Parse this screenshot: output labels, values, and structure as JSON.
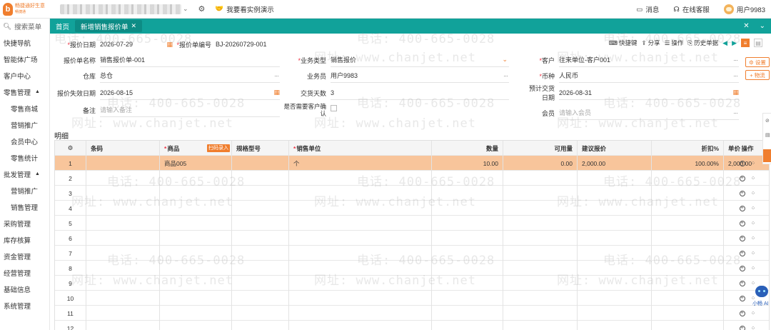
{
  "topbar": {
    "brand_line1": "畅捷通好生意",
    "brand_line2": "畅捷通",
    "demo_label": "我要看实例演示",
    "messages_label": "消息",
    "support_label": "在线客服",
    "user_label": "用户9983"
  },
  "sidebar": {
    "search_placeholder": "搜索菜单",
    "items": [
      {
        "label": "快捷导航",
        "sub": false
      },
      {
        "label": "智能体广场",
        "sub": false
      },
      {
        "label": "客户中心",
        "sub": false
      },
      {
        "label": "零售管理",
        "sub": false,
        "expanded": true
      },
      {
        "label": "零售商城",
        "sub": true
      },
      {
        "label": "营销推广",
        "sub": true
      },
      {
        "label": "会员中心",
        "sub": true
      },
      {
        "label": "零售统计",
        "sub": true
      },
      {
        "label": "批发管理",
        "sub": false,
        "expanded": true
      },
      {
        "label": "营销推广",
        "sub": true
      },
      {
        "label": "销售管理",
        "sub": true
      },
      {
        "label": "采购管理",
        "sub": false
      },
      {
        "label": "库存核算",
        "sub": false
      },
      {
        "label": "资金管理",
        "sub": false
      },
      {
        "label": "经营管理",
        "sub": false
      },
      {
        "label": "基础信息",
        "sub": false
      },
      {
        "label": "系统管理",
        "sub": false
      }
    ]
  },
  "tabs": {
    "home": "首页",
    "active": "新增销售报价单"
  },
  "toolbar": {
    "shortcut": "快捷键",
    "share": "分享",
    "operation": "操作",
    "history": "历史单据"
  },
  "form": {
    "quote_date_label": "报价日期",
    "quote_date": "2026-07-29",
    "quote_no_label": "报价单编号",
    "quote_no": "BJ-20260729-001",
    "quote_name_label": "报价单名称",
    "quote_name": "销售报价单-001",
    "biz_type_label": "业务类型",
    "biz_type": "销售报价",
    "customer_label": "客户",
    "customer": "往来单位-客户001",
    "warehouse_label": "仓库",
    "warehouse": "总仓",
    "salesman_label": "业务员",
    "salesman": "用户9983",
    "currency_label": "币种",
    "currency": "人民币",
    "expire_date_label": "报价失效日期",
    "expire_date": "2026-08-15",
    "delivery_days_label": "交货天数",
    "delivery_days": "3",
    "expected_date_label": "预计交货日期",
    "expected_date": "2026-08-31",
    "remark_label": "备注",
    "remark_placeholder": "请输入备注",
    "confirm_label_1": "是否需要客户确",
    "confirm_label_2": "认",
    "member_label": "会员",
    "member_placeholder": "请输入会员",
    "settings_btn": "设置",
    "logistics_btn": "物流"
  },
  "detail": {
    "title": "明细",
    "columns": {
      "barcode": "条码",
      "product": "商品",
      "scan_tag": "扫码录入",
      "spec": "规格型号",
      "unit": "销售单位",
      "qty": "数量",
      "available": "可用量",
      "suggest_price": "建议报价",
      "discount": "折扣%",
      "price": "单价",
      "ops": "操作"
    },
    "rows": [
      {
        "no": "1",
        "barcode": "",
        "product": "商品005",
        "spec": "",
        "unit": "个",
        "qty": "10.00",
        "available": "0.00",
        "suggest_price": "2,000.00",
        "discount": "100.00%",
        "price": "2,000.00"
      },
      {
        "no": "2"
      },
      {
        "no": "3"
      },
      {
        "no": "4"
      },
      {
        "no": "5"
      },
      {
        "no": "6"
      },
      {
        "no": "7"
      },
      {
        "no": "8"
      },
      {
        "no": "9"
      },
      {
        "no": "10"
      },
      {
        "no": "11"
      },
      {
        "no": "12"
      }
    ]
  },
  "watermark": {
    "phone": "电话: 400-665-0028",
    "url": "网址: www.chanjet.net"
  },
  "assistant": {
    "label": "小畅 AI"
  }
}
